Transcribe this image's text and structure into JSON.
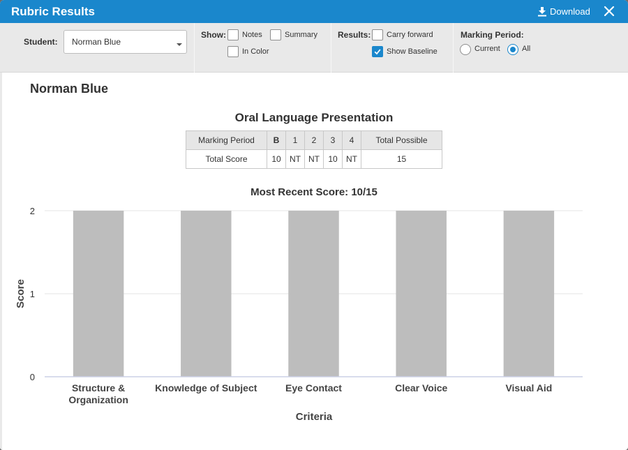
{
  "dialog": {
    "title": "Rubric Results",
    "download_label": "Download"
  },
  "filters": {
    "student_label": "Student:",
    "student_value": "Norman Blue",
    "show_label": "Show:",
    "show_options": [
      {
        "label": "Notes",
        "checked": false
      },
      {
        "label": "Summary",
        "checked": false
      },
      {
        "label": "In Color",
        "checked": false
      }
    ],
    "results_label": "Results:",
    "results_options": [
      {
        "label": "Carry forward",
        "checked": false
      },
      {
        "label": "Show Baseline",
        "checked": true
      }
    ],
    "marking_period_label": "Marking Period:",
    "marking_period_options": [
      {
        "label": "Current",
        "selected": false
      },
      {
        "label": "All",
        "selected": true
      }
    ]
  },
  "report": {
    "student_name": "Norman Blue",
    "rubric_title": "Oral Language Presentation",
    "table": {
      "headers": [
        "Marking Period",
        "B",
        "1",
        "2",
        "3",
        "4",
        "Total Possible"
      ],
      "row": [
        "Total Score",
        "10",
        "NT",
        "NT",
        "10",
        "NT",
        "15"
      ]
    }
  },
  "colors": {
    "accent": "#1a87cc",
    "bar": "#bdbdbd"
  },
  "chart_data": {
    "type": "bar",
    "title": "Most Recent Score: 10/15",
    "xlabel": "Criteria",
    "ylabel": "Score",
    "categories": [
      "Structure & Organization",
      "Knowledge of Subject",
      "Eye Contact",
      "Clear Voice",
      "Visual Aid"
    ],
    "values": [
      2,
      2,
      2,
      2,
      2
    ],
    "ylim": [
      0,
      2
    ],
    "yticks": [
      0,
      1,
      2
    ],
    "grid": true,
    "legend": "none"
  }
}
